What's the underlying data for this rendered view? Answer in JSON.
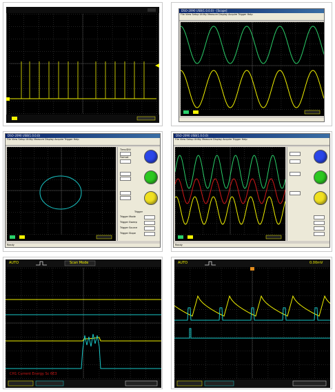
{
  "panels": {
    "p2": {
      "title": "DSO-2090 USB(1.0.0.0) - [Scope]",
      "menu": "File  View  Setup  Utility  Measure  Display  Acquire  Trigger  Help"
    },
    "p3": {
      "title": "DSO-2090 USB(1.0.0.0)",
      "menu": "File  View  Setup  Utility  Measure  Display  Acquire  Trigger  Help",
      "status_left": "Ready",
      "side": {
        "time_div": "Time/DIV",
        "format": "Format",
        "trigger": "Trigger",
        "trig_mode": "Trigger Mode",
        "trig_sweep": "Trigger Sweep",
        "trig_source": "Trigger Source",
        "trig_slope": "Trigger Slope"
      }
    },
    "p4": {
      "title": "DSO-2090 USB(1.0.0.0)",
      "menu": "File  View  Setup  Utility  Measure  Display  Acquire  Trigger  Help",
      "status_left": "Ready"
    },
    "p5": {
      "top_left": "AUTO",
      "top_center": "Scan Mode",
      "red_text": "CH1 Current Energy Sc 6E3"
    },
    "p6": {
      "top_left": "AUTO",
      "top_right": "0.00mV"
    }
  },
  "colors": {
    "yellow": "#f2f200",
    "cyan": "#19c8c8",
    "green": "#2ad06a",
    "red": "#d21818",
    "white": "#e8e8e8",
    "knob_blue": "#2a46e8",
    "knob_green": "#2cc820",
    "knob_yellow": "#f0e020"
  }
}
